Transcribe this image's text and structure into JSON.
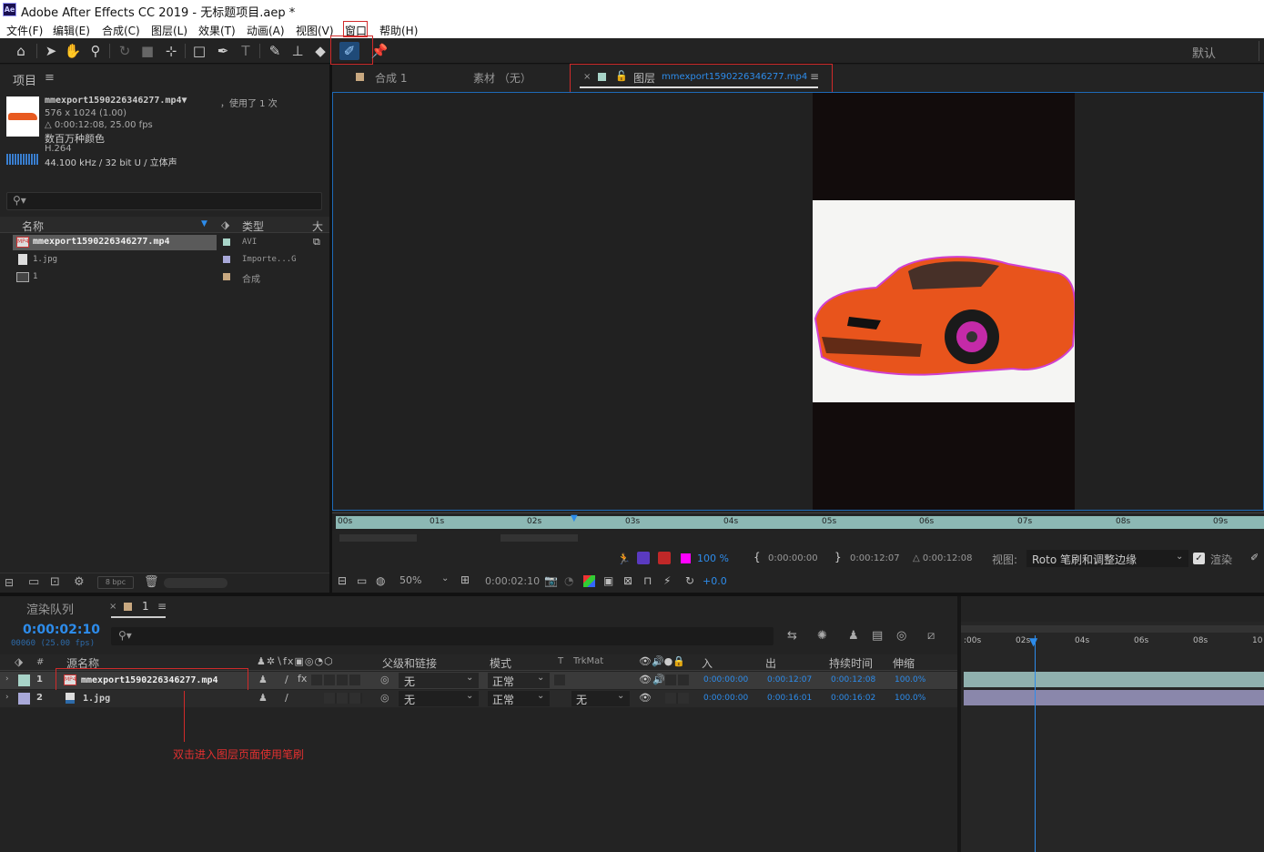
{
  "app": {
    "logo": "Ae",
    "title": "Adobe After Effects CC 2019 - 无标题项目.aep *"
  },
  "menu": [
    "文件(F)",
    "编辑(E)",
    "合成(C)",
    "图层(L)",
    "效果(T)",
    "动画(A)",
    "视图(V)",
    "窗口",
    "帮助(H)"
  ],
  "toolbar": {
    "workspace": "默认",
    "icons": [
      "home-icon",
      "selection-tool-icon",
      "hand-tool-icon",
      "zoom-tool-icon",
      "rotate-tool-icon",
      "camera-tool-icon",
      "pan-behind-tool-icon",
      "rectangle-tool-icon",
      "pen-tool-icon",
      "type-tool-icon",
      "brush-tool-icon",
      "clone-stamp-tool-icon",
      "eraser-tool-icon",
      "roto-brush-tool-icon",
      "puppet-pin-tool-icon"
    ]
  },
  "project": {
    "title": "项目",
    "file_name": "mmexport1590226346277.mp4▼",
    "used": "，使用了 1 次",
    "dimensions": "576 x 1024 (1.00)",
    "duration": "△ 0:00:12:08, 25.00 fps",
    "colors": "数百万种颜色",
    "codec": "H.264",
    "audio": "44.100 kHz / 32 bit U / 立体声",
    "search_placeholder": "",
    "col_name": "名称",
    "col_type": "类型",
    "col_size": "大",
    "items": [
      {
        "name": "mmexport1590226346277.mp4",
        "type": "AVI",
        "color": "#a8d4c8"
      },
      {
        "name": "1.jpg",
        "type": "Importe...G",
        "color": "#a8a8d8"
      },
      {
        "name": "1",
        "type": "合成",
        "color": "#c8a880"
      }
    ],
    "bpc": "8 bpc"
  },
  "viewer": {
    "tab_comp": "合成 1",
    "tab_footage": "素材 （无）",
    "tab_layer_prefix": "图层",
    "tab_layer_name": "mmexport1590226346277.mp4",
    "ruler_labels": [
      "00s",
      "01s",
      "02s",
      "03s",
      "04s",
      "05s",
      "06s",
      "07s",
      "08s",
      "09s"
    ],
    "opacity": "100 %",
    "in_time": "0:00:00:00",
    "out_time": "0:00:12:07",
    "duration": "△ 0:00:12:08",
    "view_label": "视图:",
    "view_value": "Roto 笔刷和调整边缘",
    "render_label": "渲染",
    "zoom": "50%",
    "timecode": "0:00:02:10",
    "exposure": "+0.0"
  },
  "timeline": {
    "tab_render": "渲染队列",
    "tab_comp": "1",
    "timecode": "0:00:02:10",
    "frame_info": "00060 (25.00 fps)",
    "headers": {
      "num": "#",
      "source": "源名称",
      "parent": "父级和链接",
      "mode": "模式",
      "t": "T",
      "trkmat": "TrkMat",
      "in": "入",
      "out": "出",
      "duration": "持续时间",
      "stretch": "伸缩"
    },
    "ruler": [
      ":00s",
      "02s",
      "04s",
      "06s",
      "08s",
      "10"
    ],
    "layers": [
      {
        "num": "1",
        "name": "mmexport1590226346277.mp4",
        "parent": "无",
        "mode": "正常",
        "trkmat": "",
        "in": "0:00:00:00",
        "out": "0:00:12:07",
        "duration": "0:00:12:08",
        "stretch": "100.0%",
        "color": "#a8d4c8"
      },
      {
        "num": "2",
        "name": "1.jpg",
        "parent": "无",
        "mode": "正常",
        "trkmat": "无",
        "in": "0:00:00:00",
        "out": "0:00:16:01",
        "duration": "0:00:16:02",
        "stretch": "100.0%",
        "color": "#a8a8d8"
      }
    ]
  },
  "annotation": "双击进入图层页面使用笔刷"
}
